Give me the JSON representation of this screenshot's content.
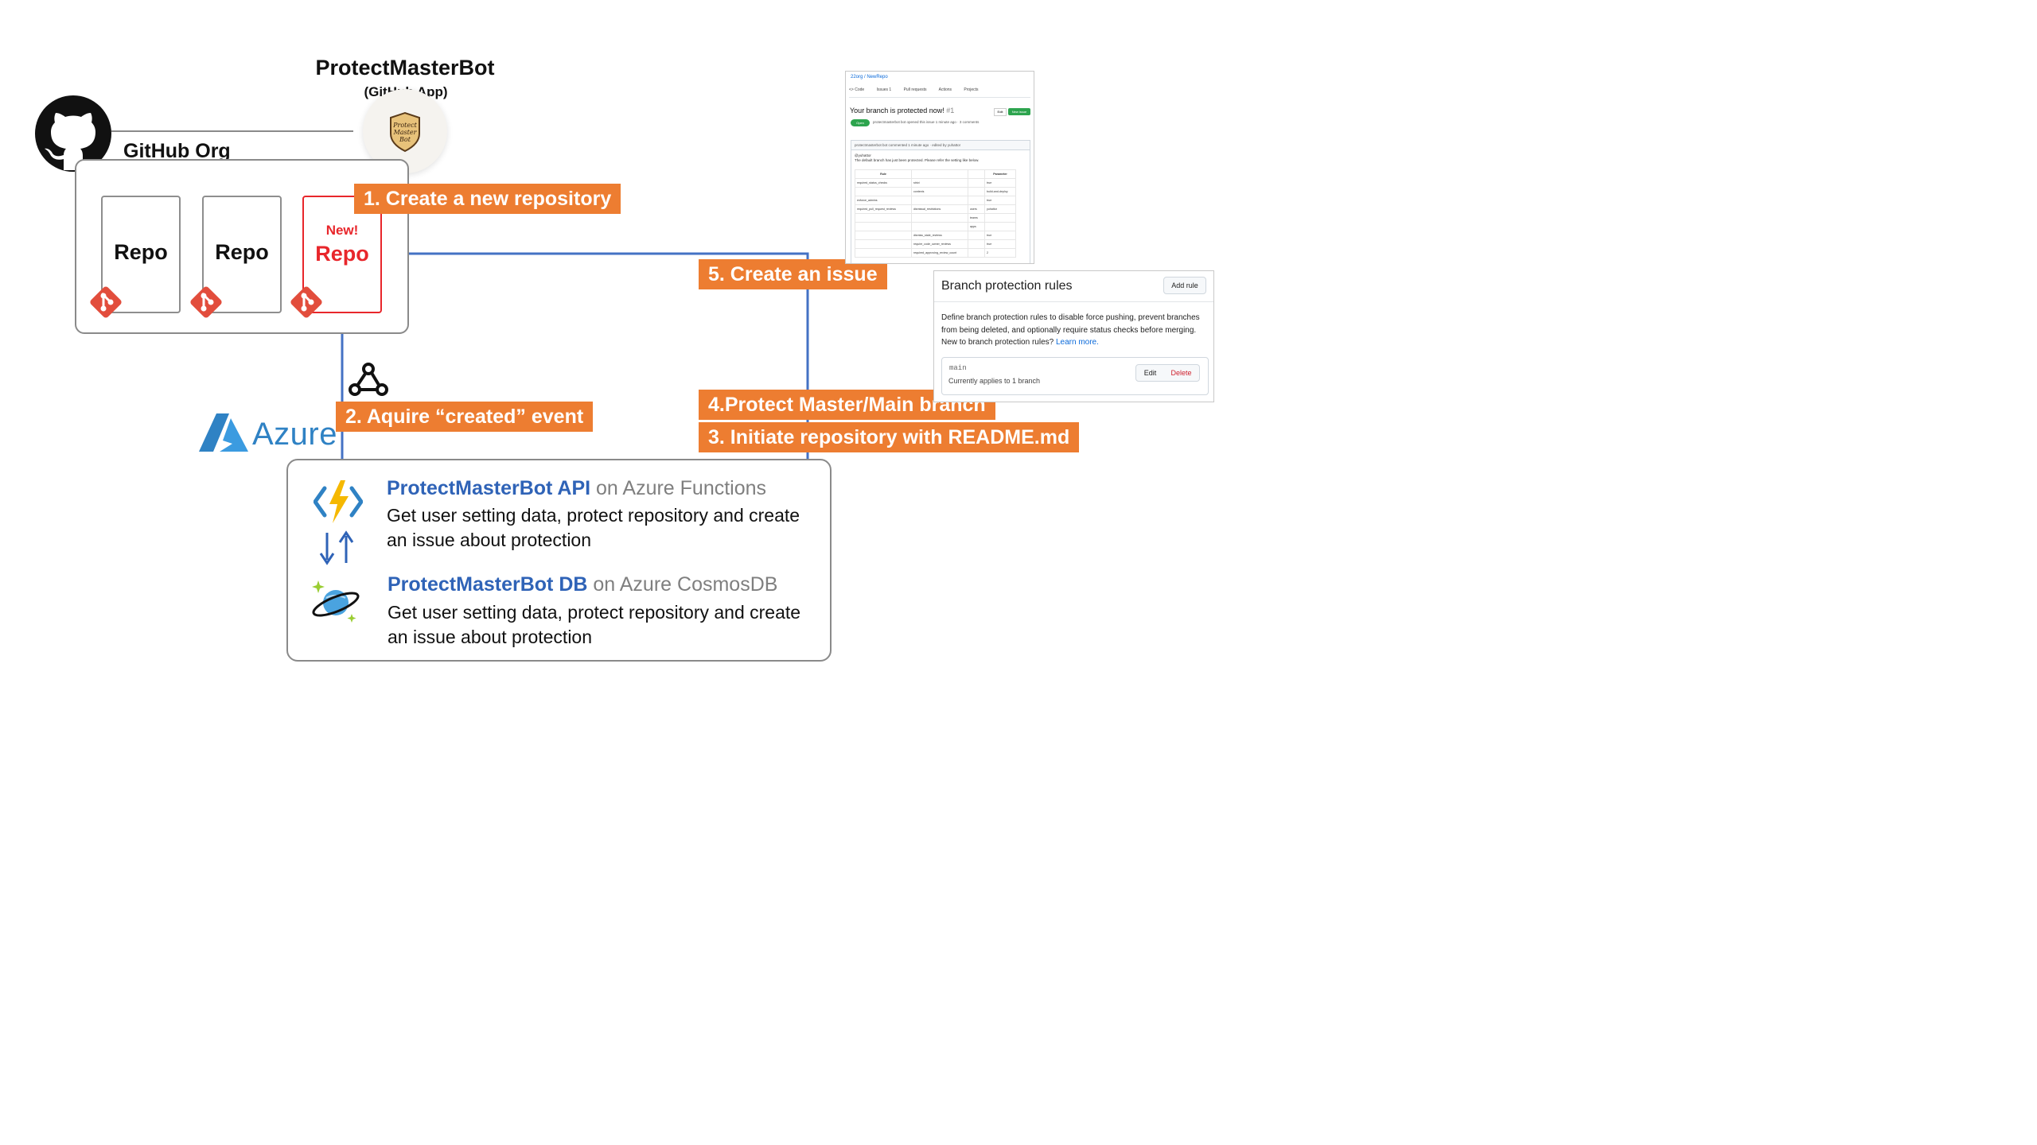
{
  "bot": {
    "name": "ProtectMasterBot",
    "subtitle": "(GitHub App)",
    "logo_text_1": "Protect",
    "logo_text_2": "Master",
    "logo_text_3": "Bot"
  },
  "org": {
    "label": "GitHub Org"
  },
  "repos": [
    {
      "name": "Repo",
      "is_new": false
    },
    {
      "name": "Repo",
      "is_new": false
    },
    {
      "name": "Repo",
      "is_new": true,
      "new_label": "New!"
    }
  ],
  "steps": {
    "s1": "1. Create a new repository",
    "s2": "2. Aquire “created” event",
    "s3": "3. Initiate repository with README.md",
    "s4": "4.Protect Master/Main branch",
    "s5": "5. Create an issue"
  },
  "azure": {
    "label": "Azure"
  },
  "services": {
    "api": {
      "title": "ProtectMasterBot API",
      "platform": " on Azure Functions",
      "desc": "Get user setting data, protect repository and create an issue about protection"
    },
    "db": {
      "title": "ProtectMasterBot DB",
      "platform": " on Azure  CosmosDB",
      "desc": "Get user setting data, protect repository and create an issue about protection"
    }
  },
  "issue_screenshot": {
    "repo_path": "22org / NewRepo",
    "tabs": [
      "<> Code",
      "Issues 1",
      "Pull requests",
      "Actions",
      "Projects"
    ],
    "title": "Your branch is protected now!",
    "number": "#1",
    "edit_label": "Edit",
    "new_issue_label": "New issue",
    "state": "Open",
    "meta": "protectmasterbot  bot  opened this issue 1 minute ago · 3 comments",
    "comment_header": "protectmasterbot  bot  commented 1 minute ago · edited by yuhattor",
    "mention": "@yuhattor",
    "body": "The default branch has just been protected. Please refer the setting like below.",
    "table_headers": [
      "Rule",
      "",
      "",
      "Parameter"
    ],
    "table_rows": [
      [
        "required_status_checks",
        "strict",
        "",
        "true"
      ],
      [
        "",
        "contexts",
        "",
        "build-and-deploy"
      ],
      [
        "enforce_admins",
        "",
        "",
        "true"
      ],
      [
        "required_pull_request_reviews",
        "dismissal_restrictions",
        "users",
        "yuhattor"
      ],
      [
        "",
        "",
        "teams",
        ""
      ],
      [
        "",
        "",
        "apps",
        ""
      ],
      [
        "",
        "dismiss_stale_reviews",
        "",
        "true"
      ],
      [
        "",
        "require_code_owner_reviews",
        "",
        "true"
      ],
      [
        "",
        "required_approving_review_count",
        "",
        "2"
      ]
    ]
  },
  "branch_rules": {
    "title": "Branch protection rules",
    "add_rule": "Add rule",
    "desc": "Define branch protection rules to disable force pushing, prevent branches from being deleted, and optionally require status checks before merging. New to branch protection rules? ",
    "learn_more": "Learn more.",
    "branch": "main",
    "applies": "Currently applies to 1 branch",
    "edit": "Edit",
    "delete": "Delete"
  },
  "colors": {
    "step_orange": "#ed7d31",
    "flow_blue": "#4472c4",
    "new_red": "#e8262b",
    "azure_blue": "#2f82c4",
    "service_blue": "#2f63b7",
    "git_red": "#e24d3c"
  }
}
